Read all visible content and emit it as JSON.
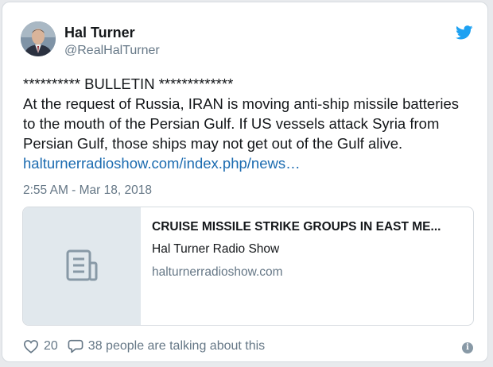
{
  "author": {
    "name": "Hal Turner",
    "handle": "@RealHalTurner"
  },
  "icons": {
    "brand": "twitter-bird-icon",
    "card_placeholder": "document-icon",
    "like": "heart-icon",
    "reply": "comment-icon",
    "info": "info-icon"
  },
  "colors": {
    "brand": "#1da1f2",
    "link": "#1b6bb0",
    "muted": "#657786"
  },
  "tweet": {
    "lines": [
      "********** BULLETIN *************",
      "At the request of Russia, IRAN is moving anti-ship missile batteries",
      "to the mouth of the Persian Gulf.  If US vessels attack Syria from",
      "Persian Gulf, those ships may not get out of the Gulf alive."
    ],
    "link_text": "halturnerradioshow.com/index.php/news…",
    "timestamp": "2:55 AM - Mar 18, 2018"
  },
  "card": {
    "title": "CRUISE MISSILE STRIKE GROUPS IN EAST ME...",
    "site_name": "Hal Turner Radio Show",
    "domain": "halturnerradioshow.com"
  },
  "footer": {
    "likes": "20",
    "talking": "38 people are talking about this",
    "info_glyph": "i"
  }
}
